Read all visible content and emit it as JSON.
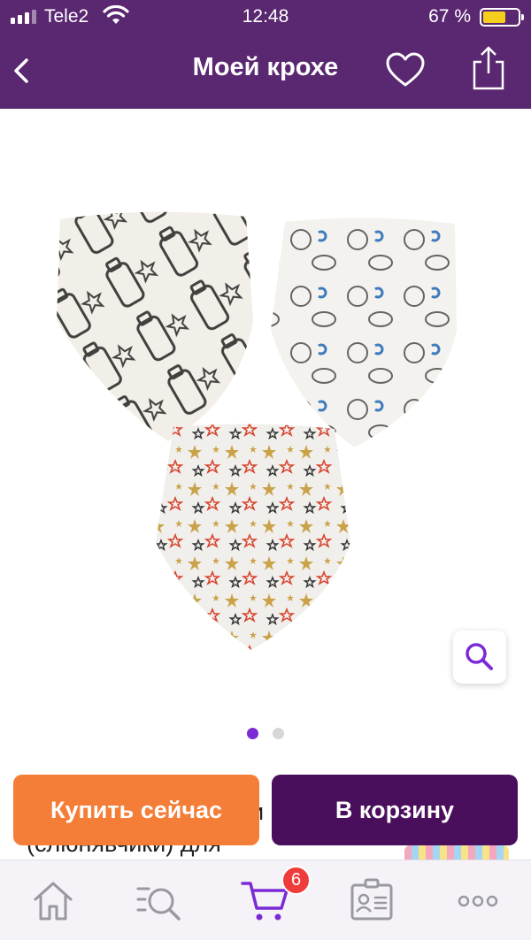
{
  "status_bar": {
    "carrier": "Tele2",
    "time": "12:48",
    "battery_percent": "67 %",
    "battery_level": 0.67
  },
  "header": {
    "title": "Моей крохе",
    "background": "#5a2771"
  },
  "gallery": {
    "page_count": 2,
    "active_page": 1,
    "images": [
      {
        "subject": "bandana-bib-milk-print"
      },
      {
        "subject": "bandana-bib-dog-print"
      },
      {
        "subject": "bandana-bib-star-print"
      }
    ]
  },
  "product": {
    "title_fragment_line1": "и",
    "title_fragment_line2": "(слюнявчики) для"
  },
  "actions": {
    "buy_now_label": "Купить сейчас",
    "add_to_cart_label": "В корзину",
    "buy_color": "#f47d38",
    "cart_color": "#4a0f5c"
  },
  "tabbar": {
    "tabs": [
      {
        "name": "home-icon",
        "active": false
      },
      {
        "name": "catalog-search-icon",
        "active": false
      },
      {
        "name": "cart-icon",
        "active": true
      },
      {
        "name": "profile-card-icon",
        "active": false
      },
      {
        "name": "more-icon",
        "active": false
      }
    ],
    "cart_badge": "6",
    "active_color": "#7a2bd6"
  }
}
